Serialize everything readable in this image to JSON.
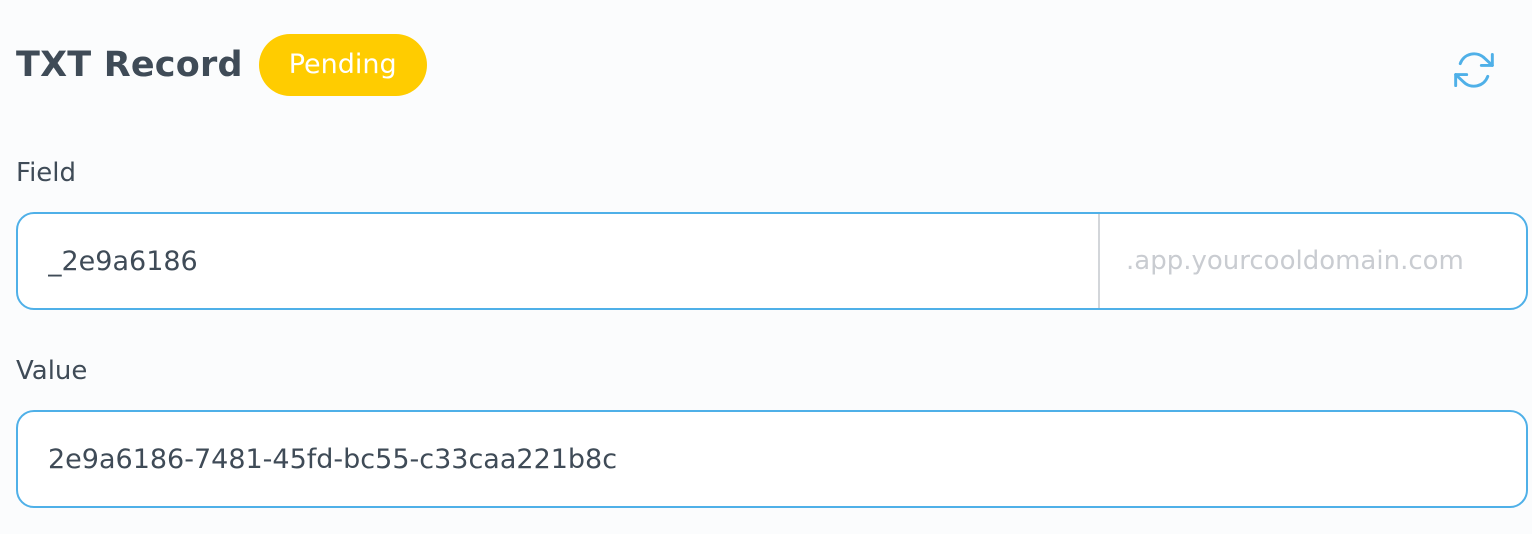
{
  "header": {
    "title": "TXT Record",
    "status_badge": "Pending",
    "refresh_icon": "refresh-icon"
  },
  "field": {
    "label": "Field",
    "value": "_2e9a6186",
    "suffix": ".app.yourcooldomain.com"
  },
  "value": {
    "label": "Value",
    "value": "2e9a6186-7481-45fd-bc55-c33caa221b8c"
  },
  "colors": {
    "badge_background": "#ffcc00",
    "input_border": "#4fb0e8",
    "refresh_icon": "#4fb0e8",
    "text": "#3f4b57",
    "suffix_text": "#c9ccd1"
  }
}
